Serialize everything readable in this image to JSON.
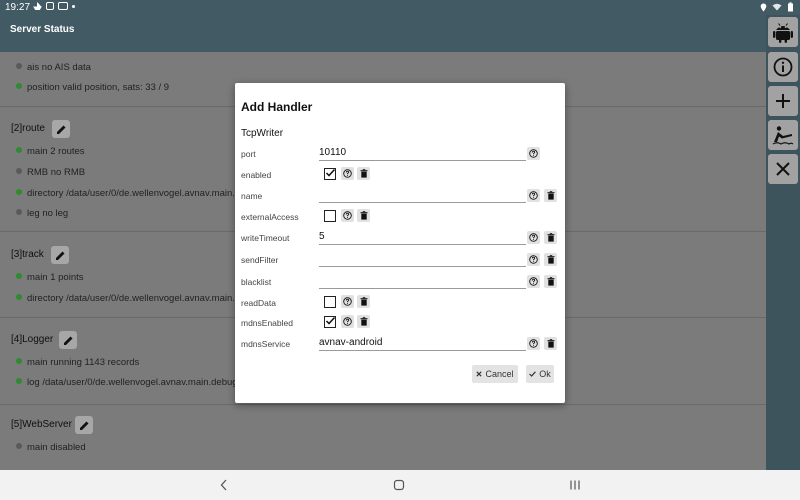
{
  "status_bar": {
    "time": "19:27"
  },
  "header": {
    "title": "Server Status"
  },
  "sections": [
    {
      "title": "",
      "rows": [
        {
          "status": "grey",
          "text": "ais no AIS data"
        },
        {
          "status": "green",
          "text": "position valid position, sats: 33 / 9"
        }
      ]
    },
    {
      "title": "[2]route",
      "rows": [
        {
          "status": "green",
          "text": "main 2 routes"
        },
        {
          "status": "grey",
          "text": "RMB no RMB"
        },
        {
          "status": "green",
          "text": "directory /data/user/0/de.wellenvogel.avnav.main..."
        },
        {
          "status": "grey",
          "text": "leg no leg"
        }
      ]
    },
    {
      "title": "[3]track",
      "rows": [
        {
          "status": "green",
          "text": "main 1 points"
        },
        {
          "status": "green",
          "text": "directory /data/user/0/de.wellenvogel.avnav.main..."
        }
      ]
    },
    {
      "title": "[4]Logger",
      "rows": [
        {
          "status": "green",
          "text": "main running 1143 records"
        },
        {
          "status": "green",
          "text": "log /data/user/0/de.wellenvogel.avnav.main.debug..."
        }
      ]
    },
    {
      "title": "[5]WebServer",
      "rows": [
        {
          "status": "grey",
          "text": "main disabled"
        }
      ]
    }
  ],
  "dialog": {
    "title": "Add Handler",
    "handler_type": "TcpWriter",
    "fields": {
      "port": {
        "label": "port",
        "value": "10110"
      },
      "enabled": {
        "label": "enabled",
        "checked": true
      },
      "name": {
        "label": "name",
        "value": ""
      },
      "externalAccess": {
        "label": "externalAccess",
        "checked": false
      },
      "writeTimeout": {
        "label": "writeTimeout",
        "value": "5"
      },
      "sendFilter": {
        "label": "sendFilter",
        "value": ""
      },
      "blacklist": {
        "label": "blacklist",
        "value": ""
      },
      "readData": {
        "label": "readData",
        "checked": false
      },
      "mdnsEnabled": {
        "label": "mdnsEnabled",
        "checked": true
      },
      "mdnsService": {
        "label": "mdnsService",
        "value": "avnav-android"
      }
    },
    "cancel_label": "Cancel",
    "ok_label": "Ok"
  },
  "toolbar": {
    "buttons": [
      "android-icon",
      "info-icon",
      "add-icon",
      "boat-icon",
      "close-icon"
    ]
  },
  "colors": {
    "header": "#415a63",
    "toolbar": "#3d545c",
    "status_green": "#2e8b2e",
    "status_grey": "#5a5a5a"
  }
}
